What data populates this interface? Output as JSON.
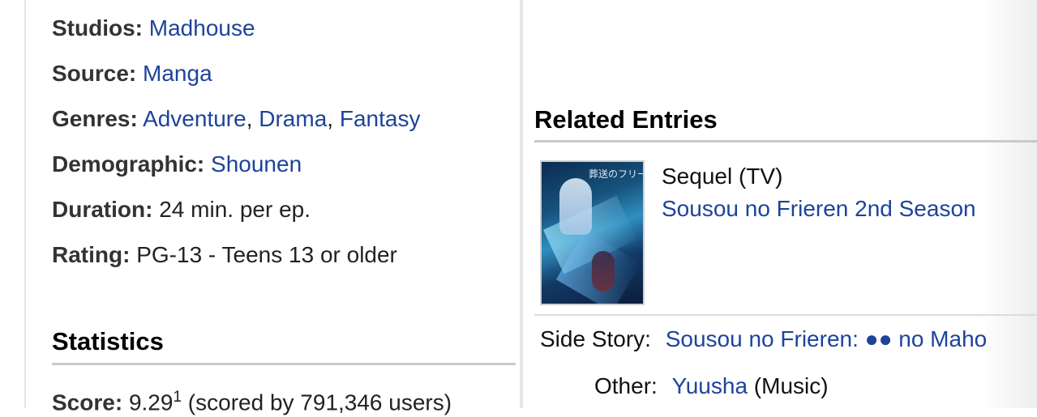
{
  "info": {
    "studios": {
      "label": "Studios:",
      "values": [
        "Madhouse"
      ]
    },
    "source": {
      "label": "Source:",
      "values": [
        "Manga"
      ]
    },
    "genres": {
      "label": "Genres:",
      "values": [
        "Adventure",
        "Drama",
        "Fantasy"
      ],
      "separator": ", "
    },
    "demographic": {
      "label": "Demographic:",
      "values": [
        "Shounen"
      ]
    },
    "duration": {
      "label": "Duration:",
      "value": "24 min. per ep."
    },
    "rating": {
      "label": "Rating:",
      "value": "PG-13 - Teens 13 or older"
    }
  },
  "statistics": {
    "title": "Statistics",
    "score_label": "Score:",
    "score_value": "9.29",
    "score_sup": "1",
    "score_suffix": "(scored by 791,346 users)"
  },
  "related": {
    "title": "Related Entries",
    "card": {
      "type": "Sequel (TV)",
      "title": "Sousou no Frieren 2nd Season",
      "thumbnail_text": "葬送のフリーレン"
    },
    "side_story": {
      "label": "Side Story:",
      "title": "Sousou no Frieren: ●● no Maho"
    },
    "other": {
      "label": "Other:",
      "title": "Yuusha",
      "suffix": "(Music)"
    }
  },
  "colors": {
    "link": "#1d439b",
    "label": "#333333"
  }
}
